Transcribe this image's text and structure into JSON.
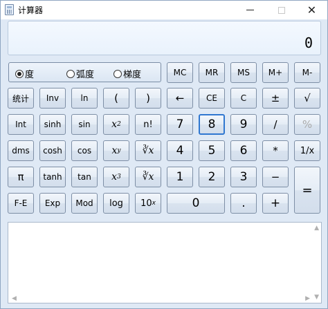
{
  "window": {
    "title": "计算器"
  },
  "display": {
    "value": "0"
  },
  "angle": {
    "options": [
      "度",
      "弧度",
      "梯度"
    ],
    "selected": "度"
  },
  "memory": [
    "MC",
    "MR",
    "MS",
    "M+",
    "M-"
  ],
  "keys": {
    "stats": "统计",
    "inv": "Inv",
    "ln": "ln",
    "lparen": "(",
    "rparen": ")",
    "back": "←",
    "ce": "CE",
    "c": "C",
    "plusminus": "±",
    "sqrt": "√",
    "int": "Int",
    "sinh": "sinh",
    "sin": "sin",
    "x2_base": "x",
    "x2_sup": "2",
    "nfact": "n!",
    "n7": "7",
    "n8": "8",
    "n9": "9",
    "div": "/",
    "percent": "%",
    "dms": "dms",
    "cosh": "cosh",
    "cos": "cos",
    "xy_base": "x",
    "xy_sup": "y",
    "yroot": "∛x",
    "n4": "4",
    "n5": "5",
    "n6": "6",
    "mul": "*",
    "recip": "1/x",
    "pi": "π",
    "tanh": "tanh",
    "tan": "tan",
    "x3_base": "x",
    "x3_sup": "3",
    "cbrt": "∛x",
    "n1": "1",
    "n2": "2",
    "n3": "3",
    "minus": "−",
    "equals": "=",
    "fe": "F-E",
    "exp": "Exp",
    "mod": "Mod",
    "log": "log",
    "tenx_base": "10",
    "tenx_sup": "x",
    "n0": "0",
    "dot": ".",
    "plus": "+"
  },
  "scroll": {
    "up": "▲",
    "down": "▼",
    "left": "◀",
    "right": "▶"
  }
}
